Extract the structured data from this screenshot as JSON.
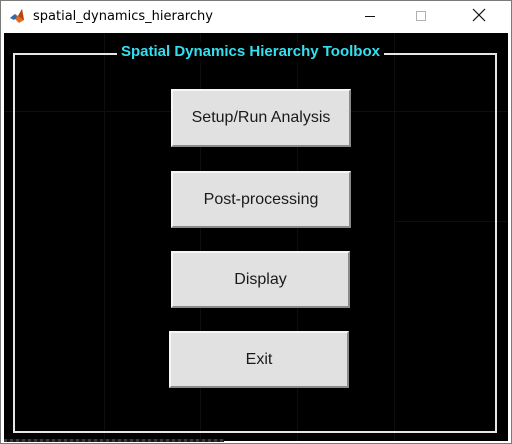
{
  "window": {
    "title": "spatial_dynamics_hierarchy",
    "controls": {
      "minimize_icon": "minimize-icon",
      "maximize_icon": "maximize-icon",
      "close_icon": "close-icon"
    }
  },
  "panel": {
    "title": "Spatial Dynamics Hierarchy Toolbox",
    "title_color": "#33e0f0",
    "background": "#000000"
  },
  "buttons": {
    "setup_run": "Setup/Run Analysis",
    "post_processing": "Post-processing",
    "display": "Display",
    "exit": "Exit"
  }
}
